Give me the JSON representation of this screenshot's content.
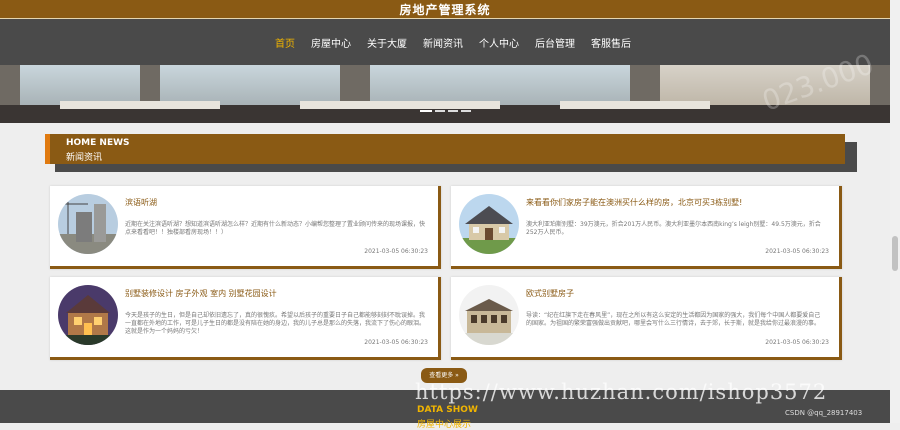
{
  "header": {
    "title": "房地产管理系统"
  },
  "nav": {
    "items": [
      "首页",
      "房屋中心",
      "关于大厦",
      "新闻资讯",
      "个人中心",
      "后台管理",
      "客服售后"
    ]
  },
  "banner": {
    "watermark": "023.000"
  },
  "news_section": {
    "title_en": "HOME NEWS",
    "title_cn": "新闻资讯"
  },
  "news": [
    {
      "title": "滨语听湖",
      "desc": "近期在关注滨语听湖？想知道滨语听湖怎么样？近期有什么新动态？小编帮您整理了置业顾问传来的现场课报，快点来看看吧！！独楼部看房现场！！）",
      "time": "2021-03-05 06:30:23",
      "img": "building-construction"
    },
    {
      "title": "来看看你们家房子能在澳洲买什么样的房，北京可买3栋别墅!",
      "desc": "澳大利亚珀斯别墅：39万澳元，折合201万人民币。澳大利亚墨尔本西南king’s leigh别墅：49.5万澳元，折合252万人民币。",
      "time": "2021-03-05 06:30:23",
      "img": "suburban-house"
    },
    {
      "title": "别墅装修设计 房子外观 室内 别墅花园设计",
      "desc": "今天是孩子的生日，但是自己却依旧遗忘了，真的很愧疚。希望以后孩子的重要日子自己都能够刻刻不耽误掉。我一直都在外地的工作，可是儿子生日的都是没有陪在她的身边，我的儿子总是那么的失落，我流下了伤心的眼泪。这就是作为一个妈妈的亏欠！",
      "time": "2021-03-05 06:30:23",
      "img": "villa-night"
    },
    {
      "title": "欧式别墅房子",
      "desc": "导读：“纪在红旗下走在春风里”，现在之所以有这么安定的生活都因为国家的强大，我们每个中国人都要爱自己的国家。为祖国的繁荣富强做出贡献吧，哪里会写什么三行情诗，去于郊，长于斯，就是我给你过最浪漫的事。",
      "time": "2021-03-05 06:30:23",
      "img": "european-house"
    }
  ],
  "more_button": "查看更多",
  "footer": {
    "title_en": "DATA SHOW",
    "title_cn": "房屋中心展示"
  },
  "overlay": {
    "url": "https://www.huzhan.com/ishop3572",
    "csdn": "CSDN @qq_28917403"
  },
  "colors": {
    "brand": "#8a5a14",
    "accent": "#f0b400",
    "dark": "#4a4a4a"
  }
}
